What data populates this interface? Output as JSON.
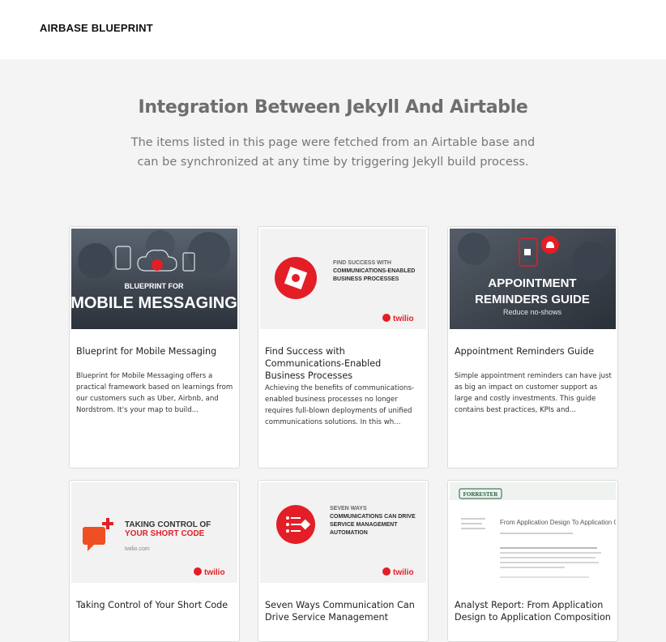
{
  "header": {
    "brand": "AIRBASE BLUEPRINT"
  },
  "hero": {
    "title": "Integration Between Jekyll And Airtable",
    "subtitle": "The items listed in this page were fetched from an Airtable base and can be synchronized at any time by triggering Jekyll build process."
  },
  "cards": [
    {
      "title": "Blueprint for Mobile Messaging",
      "description": "Blueprint for Mobile Messaging offers a practical framework based on learnings from our customers such as Uber, Airbnb, and Nordstrom. It's your map to build...",
      "image": {
        "line1": "BLUEPRINT FOR",
        "line2": "MOBILE MESSAGING"
      }
    },
    {
      "title": "Find Success with Communications-Enabled Business Processes",
      "description": "Achieving the benefits of communications-enabled business processes no longer requires full-blown deployments of unified communications solutions. In this wh...",
      "image": {
        "line1": "FIND SUCCESS WITH",
        "line2": "COMMUNICATIONS-ENABLED",
        "line3": "BUSINESS PROCESSES",
        "logo": "twilio"
      }
    },
    {
      "title": "Appointment Reminders Guide",
      "description": "Simple appointment reminders can have just as big an impact on customer support as large and costly investments. This guide contains best practices, KPIs and...",
      "image": {
        "line1": "APPOINTMENT",
        "line2": "REMINDERS GUIDE",
        "line3": "Reduce no-shows"
      }
    },
    {
      "title": "Taking Control of Your Short Code",
      "description": "",
      "image": {
        "line1": "TAKING CONTROL OF",
        "line2": "YOUR SHORT CODE",
        "line3": "twilio.com",
        "logo": "twilio"
      }
    },
    {
      "title": "Seven Ways Communication Can Drive Service Management",
      "description": "",
      "image": {
        "line1": "SEVEN WAYS",
        "line2": "COMMUNICATIONS CAN DRIVE",
        "line3": "SERVICE MANAGEMENT",
        "line4": "AUTOMATION",
        "logo": "twilio"
      }
    },
    {
      "title": "Analyst Report: From Application Design to Application Composition",
      "description": "",
      "image": {
        "brand": "FORRESTER",
        "heading": "From Application Design To Application Composition"
      }
    }
  ],
  "colors": {
    "accent": "#e31e26",
    "dark_photo": "#2e3540",
    "text_gray": "#6e6e6e"
  }
}
